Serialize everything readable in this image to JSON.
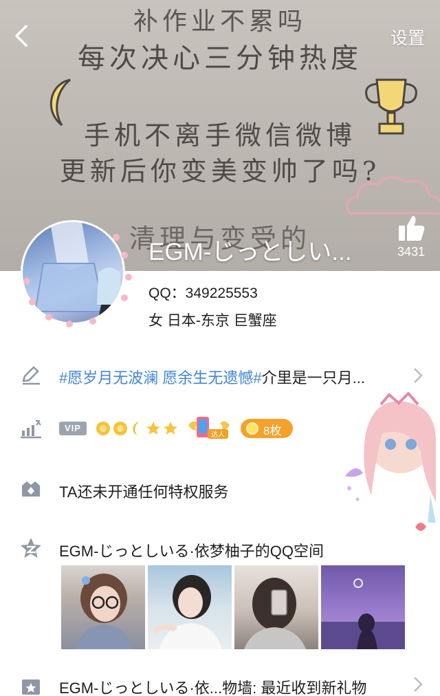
{
  "cover": {
    "lines": [
      "补作业不累吗",
      "每次决心三分钟热度",
      "手机不离手微信微博",
      "更新后你变美变帅了吗?",
      "清理与变受的"
    ]
  },
  "nav": {
    "back_label": "<",
    "settings_label": "设置"
  },
  "profile": {
    "nickname": "EGM-じっとしい...",
    "likes": "3431",
    "qq_line": "QQ：349225553",
    "location_line": "女  日本-东京  巨蟹座"
  },
  "signature": {
    "tag": "#愿岁月无波澜 愿余生无遗憾#",
    "text": "介里是一只月..."
  },
  "vip": {
    "badge": "VIP",
    "level_icons": [
      "sun-icon",
      "sun-icon",
      "moon-icon",
      "star-icon",
      "star-icon"
    ],
    "daren_label": "达人",
    "medal_count": "8枚"
  },
  "privilege": {
    "text": "TA还未开通任何特权服务"
  },
  "space": {
    "title": "EGM-じっとしいる·依梦柚子的QQ空间"
  },
  "gift": {
    "text": "EGM-じっとしいる·依...物墙: 最近收到新礼物"
  },
  "colors": {
    "tag_blue": "#3f86d6",
    "medal_orange": "#f4a22a",
    "icon_gray": "#8f97a6"
  }
}
